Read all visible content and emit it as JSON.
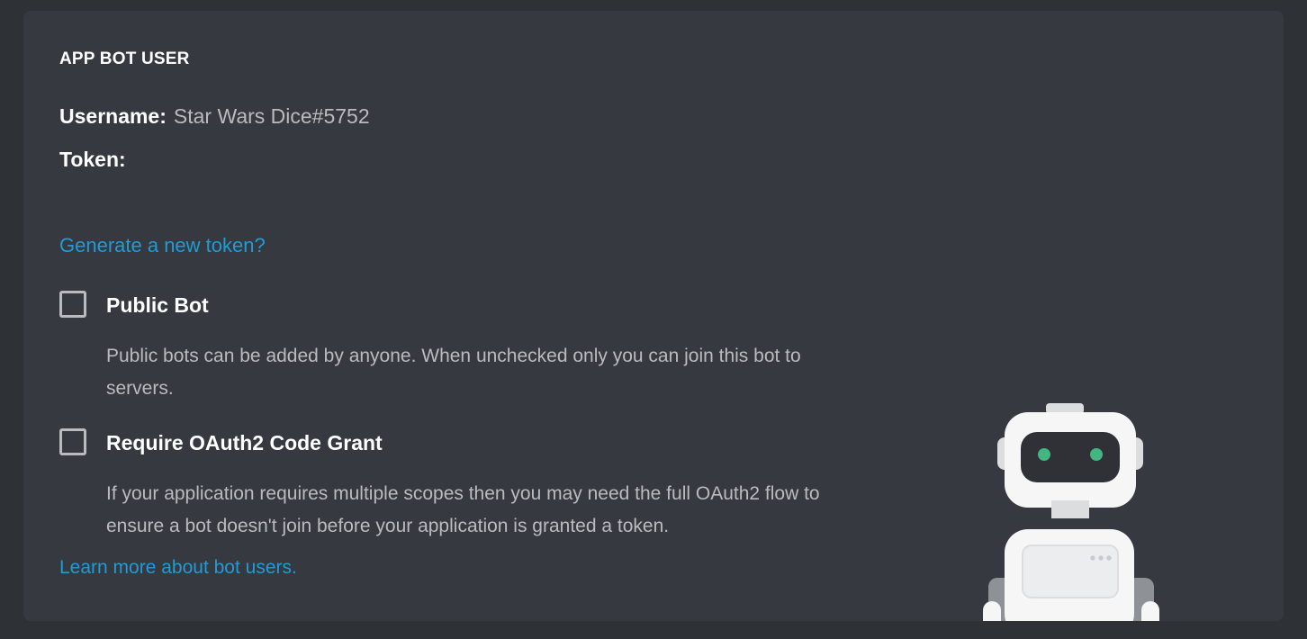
{
  "section": {
    "title": "APP BOT USER"
  },
  "username": {
    "label": "Username:",
    "value": "Star Wars Dice#5752"
  },
  "token": {
    "label": "Token:"
  },
  "links": {
    "generate_token": "Generate a new token?",
    "learn_more": "Learn more about bot users."
  },
  "options": {
    "public_bot": {
      "label": "Public Bot",
      "checked": false,
      "description": "Public bots can be added by anyone. When unchecked only you can join this bot to servers."
    },
    "oauth2": {
      "label": "Require OAuth2 Code Grant",
      "checked": false,
      "description": "If your application requires multiple scopes then you may need the full OAuth2 flow to ensure a bot doesn't join before your application is granted a token."
    }
  },
  "colors": {
    "page_bg": "#2e3136",
    "card_bg": "#36393f",
    "link": "#1f9cd6",
    "text_primary": "#ffffff",
    "text_muted": "#b9bbbe",
    "robot_eye": "#43b581"
  },
  "illustration": {
    "icon": "robot-illustration"
  }
}
